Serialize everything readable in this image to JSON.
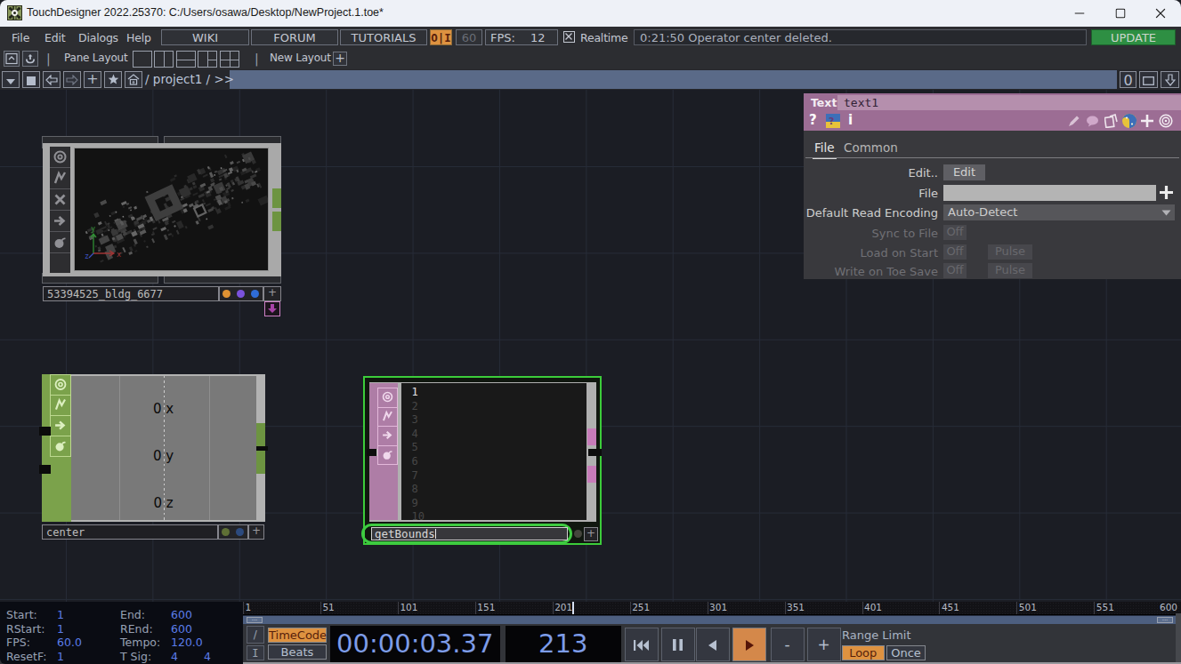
{
  "window": {
    "title": "TouchDesigner 2022.25370: C:/Users/osawa/Desktop/NewProject.1.toe*"
  },
  "menubar": {
    "menus": [
      "File",
      "Edit",
      "Dialogs",
      "Help"
    ],
    "links": [
      "WIKI",
      "FORUM",
      "TUTORIALS"
    ],
    "io_toggle": "O|I",
    "fps_cap": "60",
    "fps_label": "FPS:",
    "fps_value": "12",
    "realtime_label": "Realtime",
    "status_message": "0:21:50 Operator center deleted.",
    "update_label": "UPDATE"
  },
  "pane_toolbar": {
    "pane_layout_label": "Pane Layout",
    "new_layout_label": "New Layout",
    "plus": "+",
    "divider": "|"
  },
  "pathbar": {
    "path": "/ project1 / >>",
    "depth_button": "0",
    "plus_button": "+"
  },
  "ui": {
    "plus": "+",
    "grip_dots": "..."
  },
  "network": {
    "top_node": {
      "name": "53394525_bldg_6677"
    },
    "chop_node": {
      "name": "center",
      "channels": [
        "0 x",
        "0 y",
        "0 z"
      ]
    },
    "dat_node": {
      "rename_value": "getBounds",
      "lines": [
        "1",
        "2",
        "3",
        "4",
        "5",
        "6",
        "7",
        "8",
        "9",
        "10"
      ]
    }
  },
  "params": {
    "family": "Text",
    "name": "text1",
    "help_icon": "?",
    "info_icon": "i",
    "tabs": [
      "File",
      "Common"
    ],
    "edit_label": "Edit..",
    "edit_button": "Edit",
    "file_label": "File",
    "file_value": "",
    "encoding_label": "Default Read Encoding",
    "encoding_value": "Auto-Detect",
    "sync_label": "Sync to File",
    "sync_value": "Off",
    "load_label": "Load on Start",
    "load_value": "Off",
    "load_pulse": "Pulse",
    "write_label": "Write on Toe Save",
    "write_value": "Off",
    "write_pulse": "Pulse"
  },
  "timeline": {
    "info": {
      "rows": [
        {
          "label": "Start:",
          "value": "1"
        },
        {
          "label": "End:",
          "value": "600"
        },
        {
          "label": "RStart:",
          "value": "1"
        },
        {
          "label": "REnd:",
          "value": "600"
        },
        {
          "label": "FPS:",
          "value": "60.0"
        },
        {
          "label": "Tempo:",
          "value": "120.0"
        },
        {
          "label": "ResetF:",
          "value": "1"
        },
        {
          "label": "T Sig:",
          "value": "4",
          "value2": "4"
        }
      ]
    },
    "ruler_ticks": [
      "1",
      "51",
      "101",
      "151",
      "201",
      "251",
      "301",
      "351",
      "401",
      "451",
      "501",
      "551",
      "600"
    ],
    "mode": {
      "slash": "/",
      "bar": "I",
      "timecode": "TimeCode",
      "beats": "Beats"
    },
    "time_display": "00:00:03.37",
    "frame_display": "213",
    "step_minus": "-",
    "step_plus": "+",
    "range_limit_label": "Range Limit",
    "loop": "Loop",
    "once": "Once"
  }
}
